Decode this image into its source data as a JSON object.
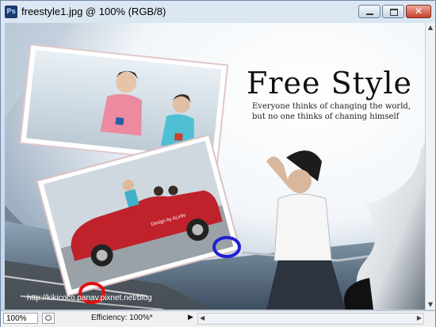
{
  "window": {
    "title": "freestyle1.jpg @ 100% (RGB/8)",
    "app_icon_text": "Ps",
    "close_glyph": "✕"
  },
  "poster": {
    "title": "Free Style",
    "tagline_line1": "Everyone thinks of changing the world,",
    "tagline_line2": "but no one thinks of chaning himself",
    "car_text": "Design by ALVIN",
    "credit_url": "http://kikicoco.panav.pixnet.net/blog"
  },
  "annotations": {
    "blue_circle_color": "#1f1fd6",
    "red_circle_color": "#e01010"
  },
  "statusbar": {
    "zoom": "100%",
    "efficiency": "Efficiency: 100%*",
    "arrow": "▶"
  },
  "colors": {
    "titlebar": "#dce7f3",
    "car_red": "#c0222c",
    "shirt_teal": "#3fb0c8"
  }
}
